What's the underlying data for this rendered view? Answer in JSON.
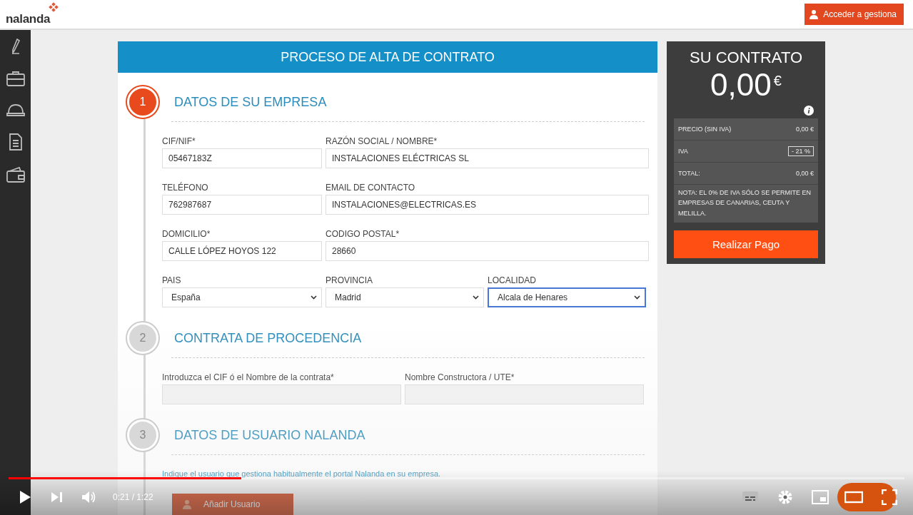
{
  "header": {
    "logo": "nalanda",
    "account_button": "Acceder a gestiona"
  },
  "form": {
    "title": "PROCESO DE ALTA DE CONTRATO",
    "steps": [
      {
        "number": "1",
        "title": "DATOS DE SU EMPRESA",
        "selected": true,
        "rows": [
          [
            {
              "kind": "input",
              "label": "CIF/NIF*",
              "value": "05467183Z"
            },
            {
              "kind": "input",
              "label": "RAZÓN SOCIAL / NOMBRE*",
              "value": "INSTALACIONES ELÉCTRICAS SL"
            }
          ],
          [
            {
              "kind": "input",
              "label": "TELÉFONO",
              "value": "762987687"
            },
            {
              "kind": "input",
              "label": "EMAIL DE CONTACTO",
              "value": "INSTALACIONES@ELECTRICAS.ES"
            }
          ],
          [
            {
              "kind": "input",
              "label": "DOMICILIO*",
              "value": "CALLE LÓPEZ HOYOS 122"
            },
            {
              "kind": "input",
              "label": "CODIGO POSTAL*",
              "value": "28660"
            }
          ],
          [
            {
              "kind": "select",
              "label": "PAIS",
              "value": "España",
              "focused": false
            },
            {
              "kind": "select",
              "label": "PROVINCIA",
              "value": "Madrid",
              "focused": false
            },
            {
              "kind": "select",
              "label": "LOCALIDAD",
              "value": "Alcala de Henares",
              "focused": true
            }
          ]
        ]
      },
      {
        "number": "2",
        "title": "CONTRATA DE PROCEDENCIA",
        "selected": false,
        "rows": [
          [
            {
              "kind": "input",
              "label": "Introduzca el CIF ó el Nombre de la contrata*"
            },
            {
              "kind": "input",
              "label": "Nombre Constructora / UTE*"
            }
          ]
        ]
      },
      {
        "number": "3",
        "title": "DATOS DE USUARIO NALANDA",
        "selected": false,
        "note": "Indique el usuario que gestiona habitualmente el portal Nalanda en su empresa.",
        "button": "Añadir Usuario"
      }
    ]
  },
  "summary": {
    "title": "SU CONTRATO",
    "amount": "0,00",
    "currency": "€",
    "rows": [
      {
        "kind": "text",
        "label": "PRECIO (SIN IVA)",
        "value": "0,00 €"
      },
      {
        "kind": "badge",
        "label": "IVA",
        "value": "- 21 %"
      },
      {
        "kind": "text",
        "label": "TOTAL:",
        "value": "0,00 €"
      }
    ],
    "note": "NOTA: EL 0% DE IVA SÓLO SE PERMITE EN EMPRESAS DE CANARIAS, CEUTA Y MELILLA.",
    "pay_button": "Realizar Pago"
  },
  "player": {
    "level": 0.26,
    "time": "0:21 / 1:22"
  }
}
